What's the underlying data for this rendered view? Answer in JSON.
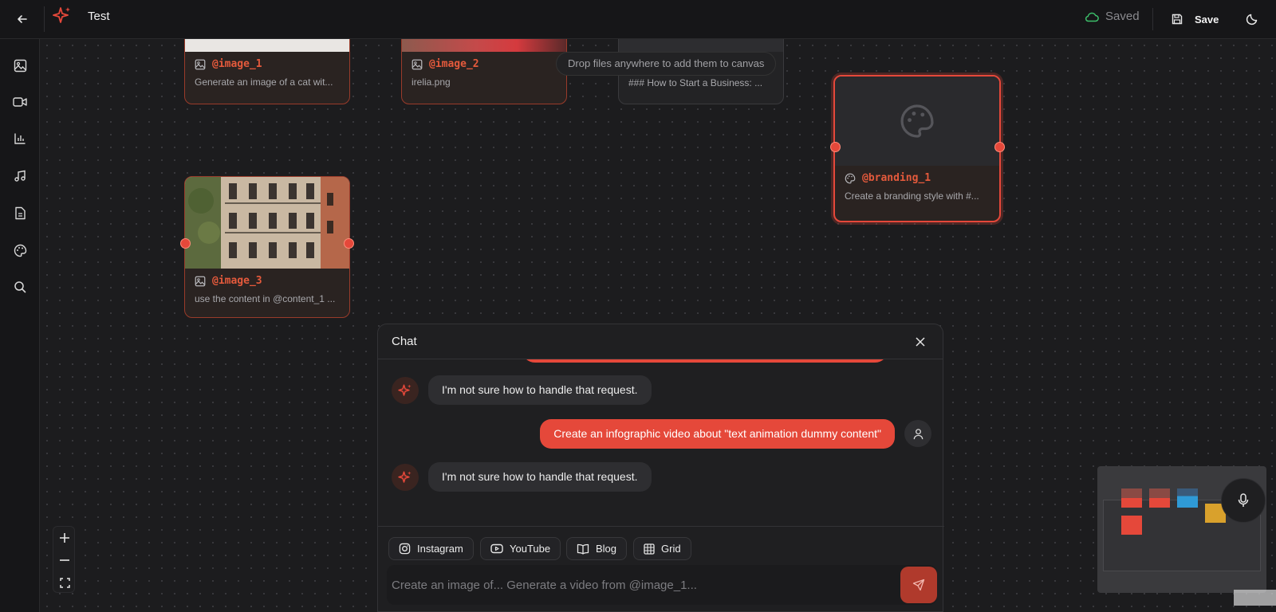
{
  "header": {
    "title": "Test",
    "status": "Saved",
    "save_label": "Save"
  },
  "sidebar": {
    "items": [
      {
        "name": "image-icon"
      },
      {
        "name": "video-icon"
      },
      {
        "name": "chart-icon"
      },
      {
        "name": "music-icon"
      },
      {
        "name": "document-icon"
      },
      {
        "name": "palette-icon"
      },
      {
        "name": "search-icon"
      }
    ]
  },
  "canvas": {
    "drop_hint": "Drop files anywhere to add them to canvas",
    "nodes": {
      "image_1": {
        "tag": "@image_1",
        "desc": "Generate an image of a cat wit..."
      },
      "image_2": {
        "tag": "@image_2",
        "desc": "irelia.png"
      },
      "content_1": {
        "desc": "### How to Start a Business: ..."
      },
      "branding_1": {
        "tag": "@branding_1",
        "desc": "Create a branding style with #..."
      },
      "image_3": {
        "tag": "@image_3",
        "desc": "use the content in @content_1 ..."
      }
    }
  },
  "chat": {
    "title": "Chat",
    "messages": [
      {
        "role": "assistant",
        "text": "I'm not sure how to handle that request."
      },
      {
        "role": "user",
        "text": "Create an infographic video about \"text animation dummy content\""
      },
      {
        "role": "assistant",
        "text": "I'm not sure how to handle that request."
      }
    ],
    "chips": [
      "Instagram",
      "YouTube",
      "Blog",
      "Grid"
    ],
    "input_placeholder": "Create an image of... Generate a video from @image_1..."
  },
  "colors": {
    "accent": "#e5483a",
    "saved_icon": "#3cbf6a"
  }
}
